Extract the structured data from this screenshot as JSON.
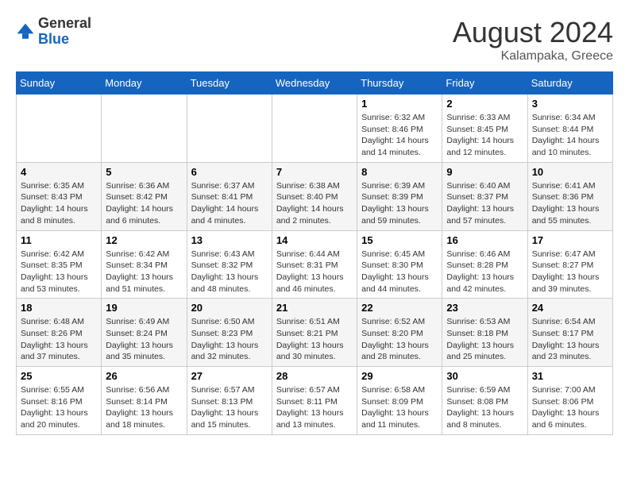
{
  "header": {
    "logo_general": "General",
    "logo_blue": "Blue",
    "month_year": "August 2024",
    "location": "Kalampaka, Greece"
  },
  "weekdays": [
    "Sunday",
    "Monday",
    "Tuesday",
    "Wednesday",
    "Thursday",
    "Friday",
    "Saturday"
  ],
  "weeks": [
    [
      {
        "day": "",
        "sunrise": "",
        "sunset": "",
        "daylight": ""
      },
      {
        "day": "",
        "sunrise": "",
        "sunset": "",
        "daylight": ""
      },
      {
        "day": "",
        "sunrise": "",
        "sunset": "",
        "daylight": ""
      },
      {
        "day": "",
        "sunrise": "",
        "sunset": "",
        "daylight": ""
      },
      {
        "day": "1",
        "sunrise": "Sunrise: 6:32 AM",
        "sunset": "Sunset: 8:46 PM",
        "daylight": "Daylight: 14 hours and 14 minutes."
      },
      {
        "day": "2",
        "sunrise": "Sunrise: 6:33 AM",
        "sunset": "Sunset: 8:45 PM",
        "daylight": "Daylight: 14 hours and 12 minutes."
      },
      {
        "day": "3",
        "sunrise": "Sunrise: 6:34 AM",
        "sunset": "Sunset: 8:44 PM",
        "daylight": "Daylight: 14 hours and 10 minutes."
      }
    ],
    [
      {
        "day": "4",
        "sunrise": "Sunrise: 6:35 AM",
        "sunset": "Sunset: 8:43 PM",
        "daylight": "Daylight: 14 hours and 8 minutes."
      },
      {
        "day": "5",
        "sunrise": "Sunrise: 6:36 AM",
        "sunset": "Sunset: 8:42 PM",
        "daylight": "Daylight: 14 hours and 6 minutes."
      },
      {
        "day": "6",
        "sunrise": "Sunrise: 6:37 AM",
        "sunset": "Sunset: 8:41 PM",
        "daylight": "Daylight: 14 hours and 4 minutes."
      },
      {
        "day": "7",
        "sunrise": "Sunrise: 6:38 AM",
        "sunset": "Sunset: 8:40 PM",
        "daylight": "Daylight: 14 hours and 2 minutes."
      },
      {
        "day": "8",
        "sunrise": "Sunrise: 6:39 AM",
        "sunset": "Sunset: 8:39 PM",
        "daylight": "Daylight: 13 hours and 59 minutes."
      },
      {
        "day": "9",
        "sunrise": "Sunrise: 6:40 AM",
        "sunset": "Sunset: 8:37 PM",
        "daylight": "Daylight: 13 hours and 57 minutes."
      },
      {
        "day": "10",
        "sunrise": "Sunrise: 6:41 AM",
        "sunset": "Sunset: 8:36 PM",
        "daylight": "Daylight: 13 hours and 55 minutes."
      }
    ],
    [
      {
        "day": "11",
        "sunrise": "Sunrise: 6:42 AM",
        "sunset": "Sunset: 8:35 PM",
        "daylight": "Daylight: 13 hours and 53 minutes."
      },
      {
        "day": "12",
        "sunrise": "Sunrise: 6:42 AM",
        "sunset": "Sunset: 8:34 PM",
        "daylight": "Daylight: 13 hours and 51 minutes."
      },
      {
        "day": "13",
        "sunrise": "Sunrise: 6:43 AM",
        "sunset": "Sunset: 8:32 PM",
        "daylight": "Daylight: 13 hours and 48 minutes."
      },
      {
        "day": "14",
        "sunrise": "Sunrise: 6:44 AM",
        "sunset": "Sunset: 8:31 PM",
        "daylight": "Daylight: 13 hours and 46 minutes."
      },
      {
        "day": "15",
        "sunrise": "Sunrise: 6:45 AM",
        "sunset": "Sunset: 8:30 PM",
        "daylight": "Daylight: 13 hours and 44 minutes."
      },
      {
        "day": "16",
        "sunrise": "Sunrise: 6:46 AM",
        "sunset": "Sunset: 8:28 PM",
        "daylight": "Daylight: 13 hours and 42 minutes."
      },
      {
        "day": "17",
        "sunrise": "Sunrise: 6:47 AM",
        "sunset": "Sunset: 8:27 PM",
        "daylight": "Daylight: 13 hours and 39 minutes."
      }
    ],
    [
      {
        "day": "18",
        "sunrise": "Sunrise: 6:48 AM",
        "sunset": "Sunset: 8:26 PM",
        "daylight": "Daylight: 13 hours and 37 minutes."
      },
      {
        "day": "19",
        "sunrise": "Sunrise: 6:49 AM",
        "sunset": "Sunset: 8:24 PM",
        "daylight": "Daylight: 13 hours and 35 minutes."
      },
      {
        "day": "20",
        "sunrise": "Sunrise: 6:50 AM",
        "sunset": "Sunset: 8:23 PM",
        "daylight": "Daylight: 13 hours and 32 minutes."
      },
      {
        "day": "21",
        "sunrise": "Sunrise: 6:51 AM",
        "sunset": "Sunset: 8:21 PM",
        "daylight": "Daylight: 13 hours and 30 minutes."
      },
      {
        "day": "22",
        "sunrise": "Sunrise: 6:52 AM",
        "sunset": "Sunset: 8:20 PM",
        "daylight": "Daylight: 13 hours and 28 minutes."
      },
      {
        "day": "23",
        "sunrise": "Sunrise: 6:53 AM",
        "sunset": "Sunset: 8:18 PM",
        "daylight": "Daylight: 13 hours and 25 minutes."
      },
      {
        "day": "24",
        "sunrise": "Sunrise: 6:54 AM",
        "sunset": "Sunset: 8:17 PM",
        "daylight": "Daylight: 13 hours and 23 minutes."
      }
    ],
    [
      {
        "day": "25",
        "sunrise": "Sunrise: 6:55 AM",
        "sunset": "Sunset: 8:16 PM",
        "daylight": "Daylight: 13 hours and 20 minutes."
      },
      {
        "day": "26",
        "sunrise": "Sunrise: 6:56 AM",
        "sunset": "Sunset: 8:14 PM",
        "daylight": "Daylight: 13 hours and 18 minutes."
      },
      {
        "day": "27",
        "sunrise": "Sunrise: 6:57 AM",
        "sunset": "Sunset: 8:13 PM",
        "daylight": "Daylight: 13 hours and 15 minutes."
      },
      {
        "day": "28",
        "sunrise": "Sunrise: 6:57 AM",
        "sunset": "Sunset: 8:11 PM",
        "daylight": "Daylight: 13 hours and 13 minutes."
      },
      {
        "day": "29",
        "sunrise": "Sunrise: 6:58 AM",
        "sunset": "Sunset: 8:09 PM",
        "daylight": "Daylight: 13 hours and 11 minutes."
      },
      {
        "day": "30",
        "sunrise": "Sunrise: 6:59 AM",
        "sunset": "Sunset: 8:08 PM",
        "daylight": "Daylight: 13 hours and 8 minutes."
      },
      {
        "day": "31",
        "sunrise": "Sunrise: 7:00 AM",
        "sunset": "Sunset: 8:06 PM",
        "daylight": "Daylight: 13 hours and 6 minutes."
      }
    ]
  ]
}
